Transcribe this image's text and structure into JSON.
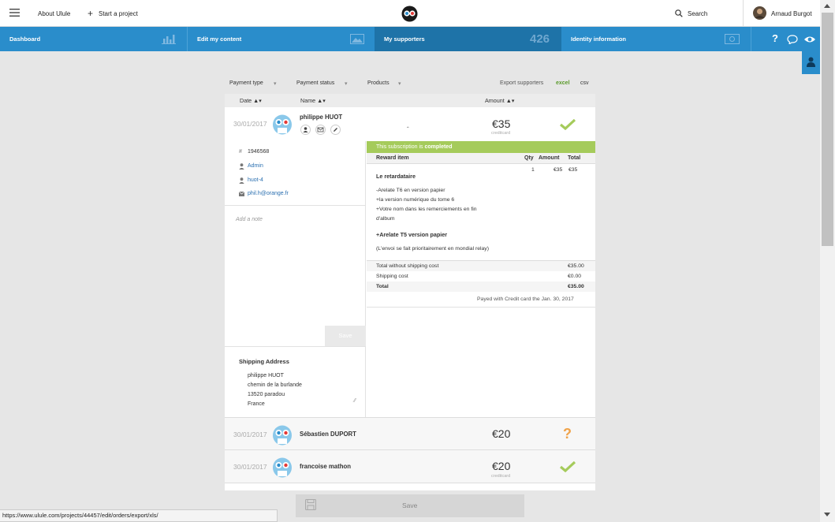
{
  "header": {
    "about": "About Ulule",
    "start_project": "Start a project",
    "search": "Search",
    "user_name": "Arnaud Burgot"
  },
  "nav": {
    "dashboard": "Dashboard",
    "edit_content": "Edit my content",
    "my_supporters": "My supporters",
    "supporters_count": "426",
    "identity": "Identity information",
    "help": "?"
  },
  "filters": {
    "payment_type": "Payment type",
    "payment_status": "Payment status",
    "products": "Products",
    "export_label": "Export supporters",
    "excel": "excel",
    "csv": "csv"
  },
  "table_header": {
    "date": "Date",
    "name": "Name",
    "amount": "Amount"
  },
  "rows": [
    {
      "date": "30/01/2017",
      "name": "philippe HUOT",
      "amount": "€35",
      "method": "creditcard",
      "status": "completed"
    },
    {
      "date": "30/01/2017",
      "name": "Sébastien DUPORT",
      "amount": "€20",
      "method": "",
      "status": "pending"
    },
    {
      "date": "30/01/2017",
      "name": "francoise mathon",
      "amount": "€20",
      "method": "creditcard",
      "status": "completed"
    }
  ],
  "expanded": {
    "order_id": "1946568",
    "user": "Admin",
    "username": "huot-4",
    "email": "phil.h@orange.fr",
    "note_placeholder": "Add a note",
    "save_note": "Save",
    "shipping_title": "Shipping Address",
    "shipping_lines": [
      "philippe HUOT",
      "chemin de la burlande",
      "13520 paradou",
      "France"
    ],
    "subscription_status_prefix": "This subscription is ",
    "subscription_status_strong": "completed",
    "reward_header": {
      "item": "Reward item",
      "qty": "Qty",
      "amount": "Amount",
      "total": "Total"
    },
    "reward": {
      "qty": "1",
      "amount": "€35",
      "total": "€35"
    },
    "reward_title": "Le retardataire",
    "reward_desc": [
      "-Arelate T6 en version papier",
      "+la version numérique du tome 6",
      "+Votre nom dans les remerciements en fin",
      "d'album"
    ],
    "reward_sub_title": "+Arelate T5 version papier",
    "reward_note": "(L'envoi se fait prioritairement en mondial relay)",
    "totals": [
      {
        "label": "Total without shipping cost",
        "value": "€35.00"
      },
      {
        "label": "Shipping cost",
        "value": "€0.00"
      },
      {
        "label": "Total",
        "value": "€35.00"
      }
    ],
    "payed_note": "Payed with Credit card the Jan. 30, 2017"
  },
  "bottom": {
    "save": "Save",
    "status_url": "https://www.ulule.com/projects/44457/edit/orders/export/xls/"
  },
  "colors": {
    "blue": "#2a8dcb",
    "blue_dark": "#1e73a8",
    "green": "#a5cb5b",
    "orange": "#f0a34a"
  }
}
